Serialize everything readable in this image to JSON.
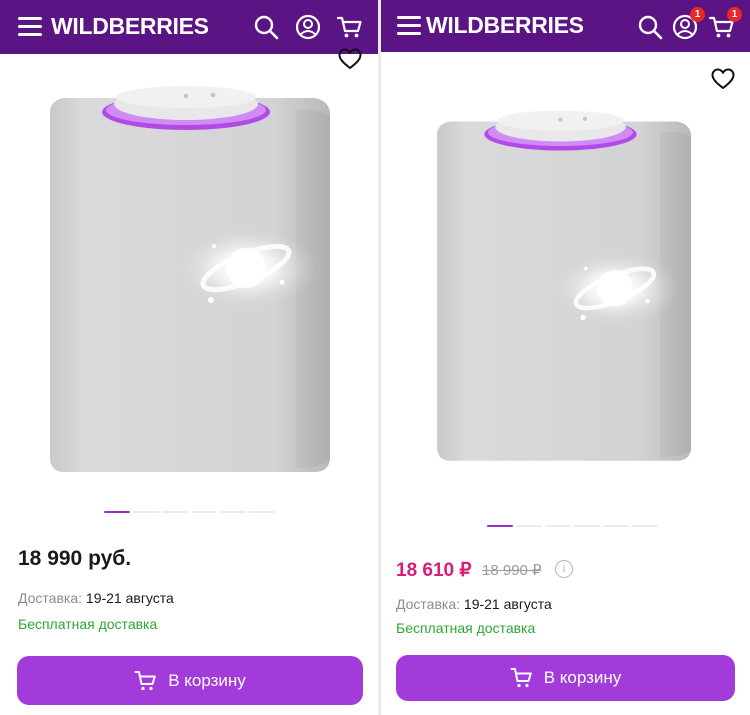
{
  "left": {
    "brand": "WILDBERRIES",
    "price": "18 990 руб.",
    "delivery_label": "Доставка:",
    "delivery_dates": "19-21 августа",
    "free_delivery": "Бесплатная доставка",
    "cart_button": "В корзину",
    "gallery": {
      "slides": 6,
      "active": 1
    }
  },
  "right": {
    "brand": "WILDBERRIES",
    "profile_badge": "1",
    "cart_badge": "1",
    "price": "18 610 ₽",
    "old_price": "18 990 ₽",
    "info_symbol": "i",
    "delivery_label": "Доставка:",
    "delivery_dates": "19-21 августа",
    "free_delivery": "Бесплатная доставка",
    "cart_button": "В корзину",
    "gallery": {
      "slides": 6,
      "active": 1
    }
  },
  "colors": {
    "header": "#5a1483",
    "button": "#a33bdb",
    "sale_price": "#d81e74",
    "free_delivery": "#2ea638",
    "badge": "#e8282b"
  },
  "icons": [
    "menu-icon",
    "search-icon",
    "profile-icon",
    "cart-icon",
    "heart-icon",
    "info-icon"
  ]
}
